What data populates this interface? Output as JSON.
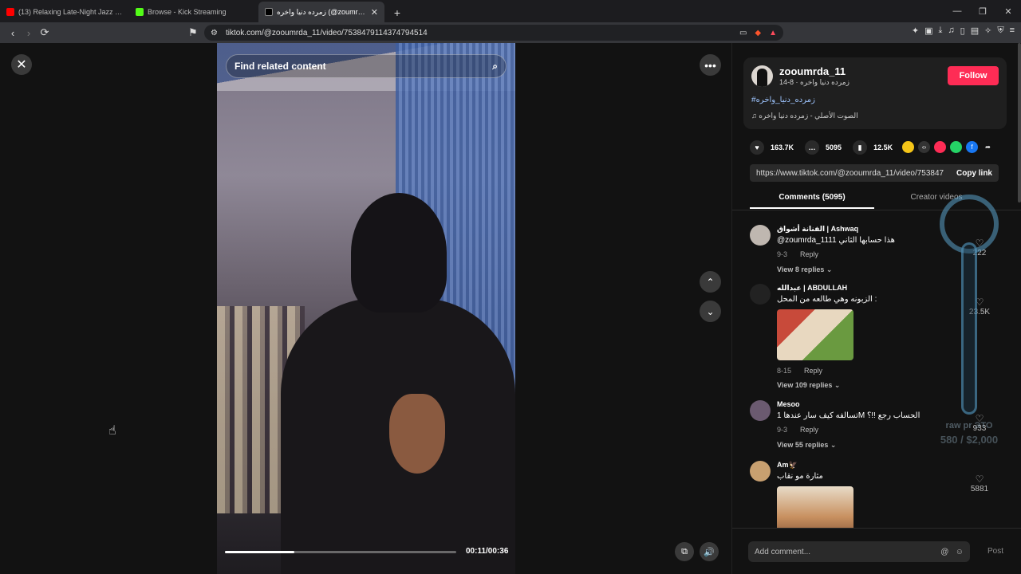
{
  "browser": {
    "tabs": [
      {
        "title": "(13) Relaxing Late-Night Jazz | Se",
        "fav_color": "#ff0000"
      },
      {
        "title": "Browse - Kick Streaming",
        "fav_color": "#53fc18"
      },
      {
        "title": "زمرده دنيا واخره (@zoumrda_11",
        "fav_color": "#000000"
      }
    ],
    "new_tab": "+",
    "url": "tiktok.com/@zooumrda_11/video/7538479114374794514"
  },
  "video": {
    "search_placeholder": "Find related content",
    "time": "00:11/00:36",
    "progress_fraction": 0.3
  },
  "author": {
    "username": "zooumrda_11",
    "subtitle": "زمرده دنيا واخره · 8-14",
    "follow_label": "Follow",
    "hashtags": "#زمرده_دنيا_واخره",
    "music": "الصوت الأصلي - زمرده دنيا واخره"
  },
  "stats": {
    "likes": "163.7K",
    "comments": "5095",
    "saves": "12.5K"
  },
  "link": {
    "url": "https://www.tiktok.com/@zooumrda_11/video/753847",
    "copy_label": "Copy link"
  },
  "tabs": {
    "comments": "Comments (5095)",
    "creator": "Creator videos"
  },
  "comments": [
    {
      "name": "الفنانة أشواق | Ashwaq",
      "text": "@zoumrda_1111 هذا حسابها الثاني",
      "date": "9-3",
      "reply": "Reply",
      "replies": "View 8 replies",
      "likes": "222",
      "avatar_color": "#bfb7b0"
    },
    {
      "name": "عبدالله | ABDULLAH",
      "text": "الزبونه وهي طالعه من المحل :",
      "date": "8-15",
      "reply": "Reply",
      "replies": "View 109 replies",
      "likes": "23.5K",
      "avatar_color": "#222222"
    },
    {
      "name": "Mesoo",
      "text": "تسالفه كيف سار عندها 1M الحساب رجع !!؟",
      "date": "9-3",
      "reply": "Reply",
      "replies": "View 55 replies",
      "likes": "933",
      "avatar_color": "#6b5a70"
    },
    {
      "name": "Am🦅",
      "text": "مثارة مو نقاب",
      "date": "",
      "reply": "",
      "replies": "",
      "likes": "5881",
      "avatar_color": "#c8a070"
    }
  ],
  "add_comment": {
    "placeholder": "Add comment...",
    "post_label": "Post"
  },
  "overlay": {
    "label": "raw pr ЭТО",
    "amount": "580 / $2,000"
  }
}
